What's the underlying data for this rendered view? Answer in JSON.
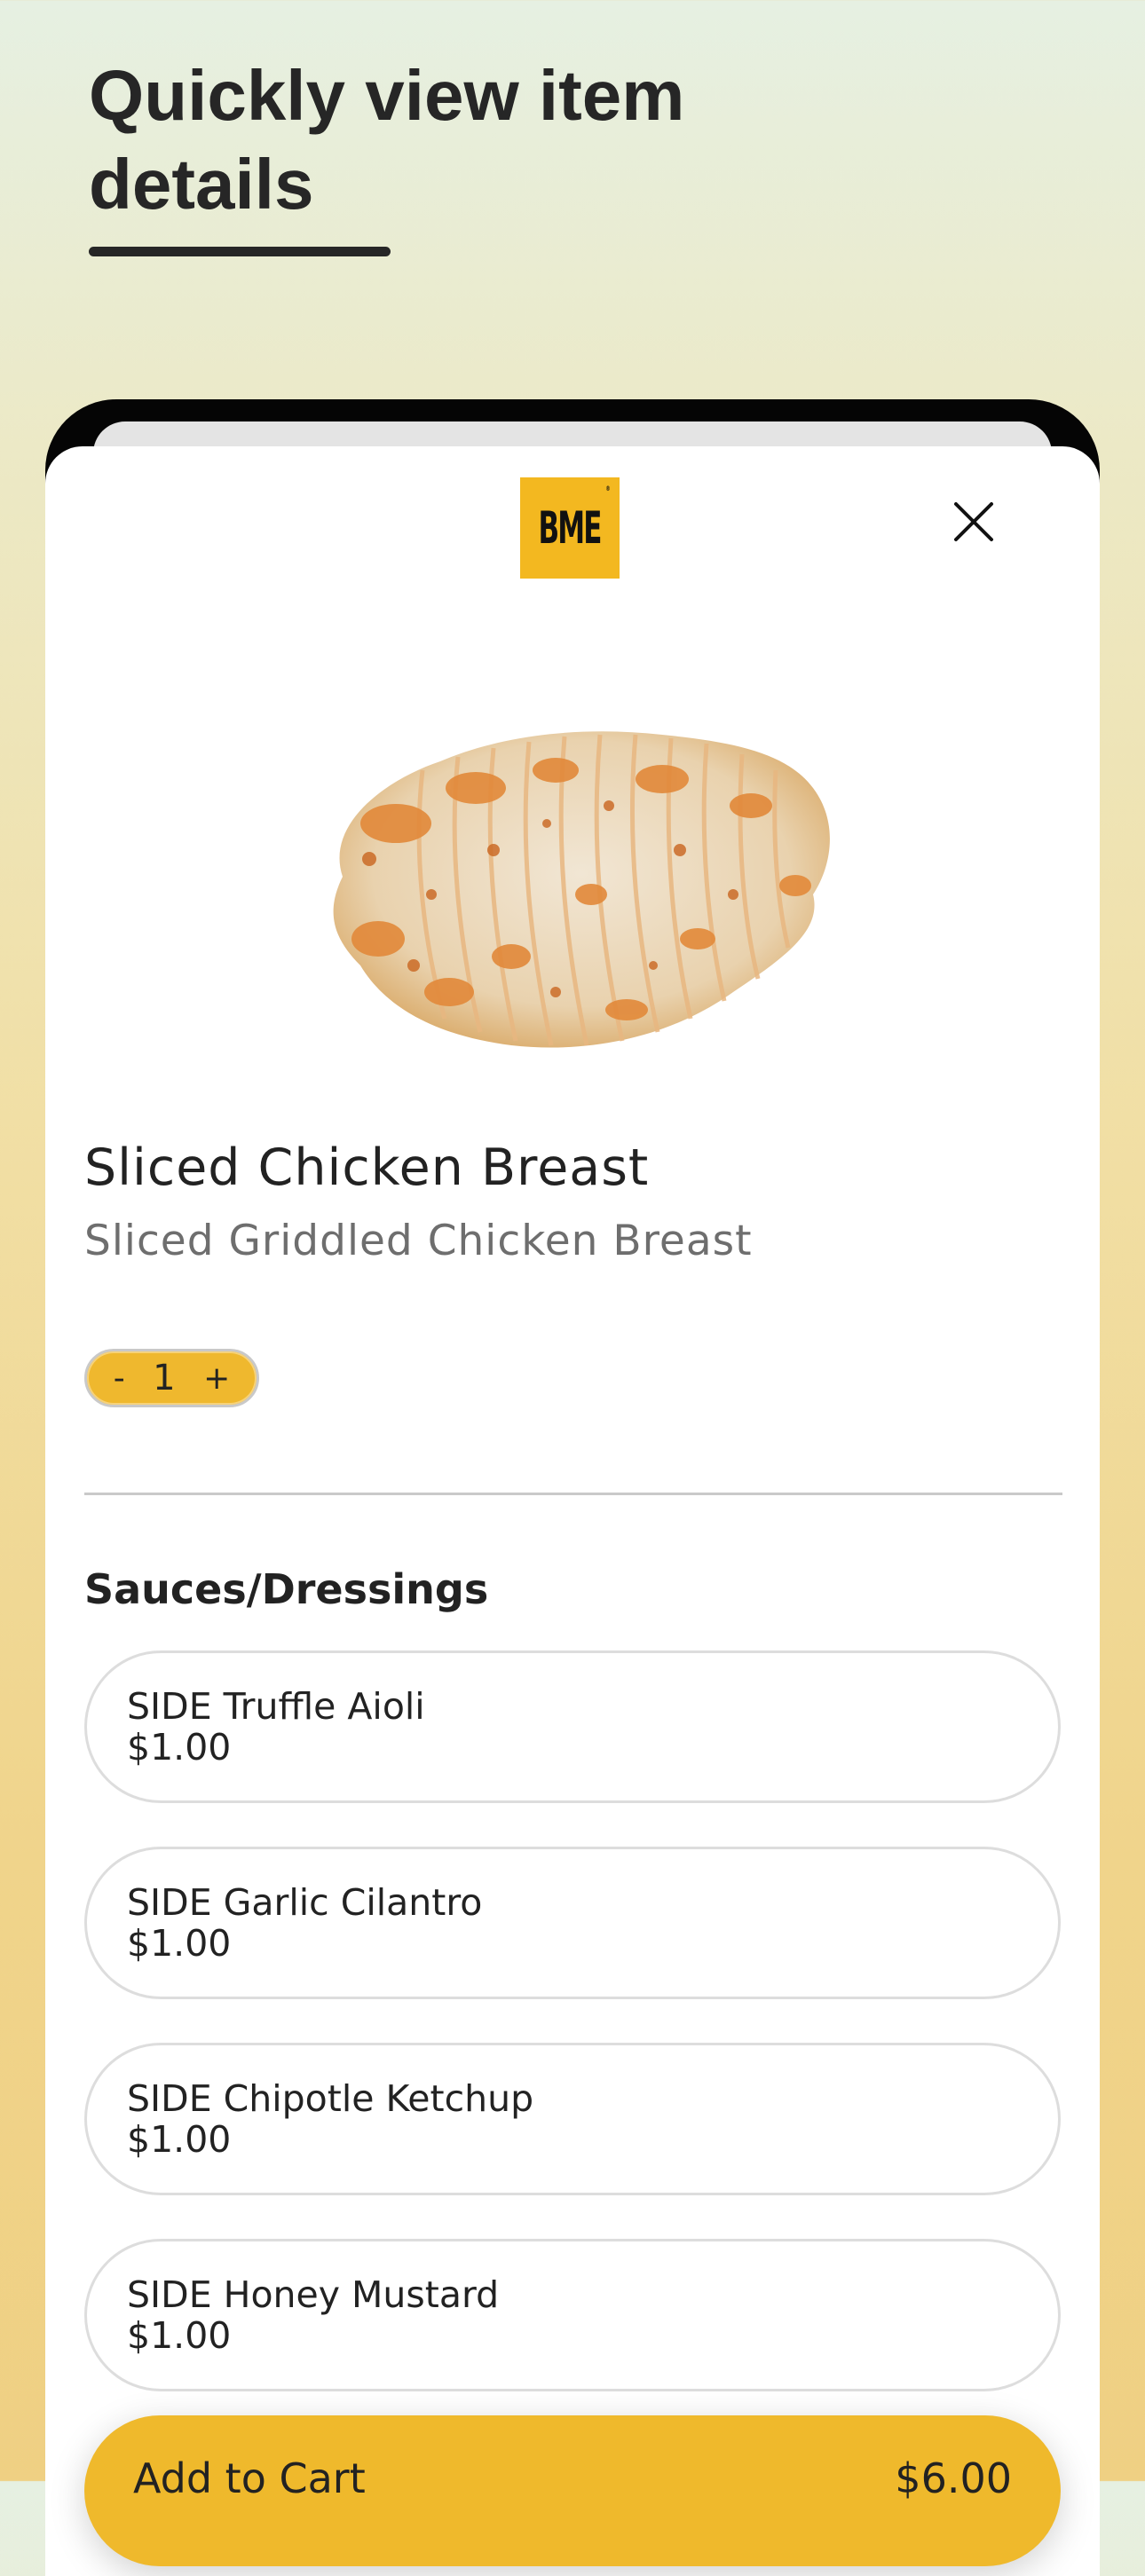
{
  "promo": {
    "title": "Quickly view item details"
  },
  "brand": {
    "logo_text": "BME",
    "logo_mark": "®",
    "accent": "#f3b820"
  },
  "header": {
    "close_icon": "close-icon"
  },
  "item": {
    "image": "sliced-chicken-image",
    "name": "Sliced Chicken Breast",
    "description": "Sliced Griddled Chicken Breast"
  },
  "quantity": {
    "decrement": "-",
    "value": "1",
    "increment": "+"
  },
  "options_section": {
    "title": "Sauces/Dressings",
    "items": [
      {
        "name": "SIDE Truffle Aioli",
        "price": "$1.00"
      },
      {
        "name": "SIDE Garlic Cilantro",
        "price": "$1.00"
      },
      {
        "name": "SIDE Chipotle Ketchup",
        "price": "$1.00"
      },
      {
        "name": "SIDE Honey Mustard",
        "price": "$1.00"
      }
    ]
  },
  "cart": {
    "label": "Add to Cart",
    "total": "$6.00"
  }
}
